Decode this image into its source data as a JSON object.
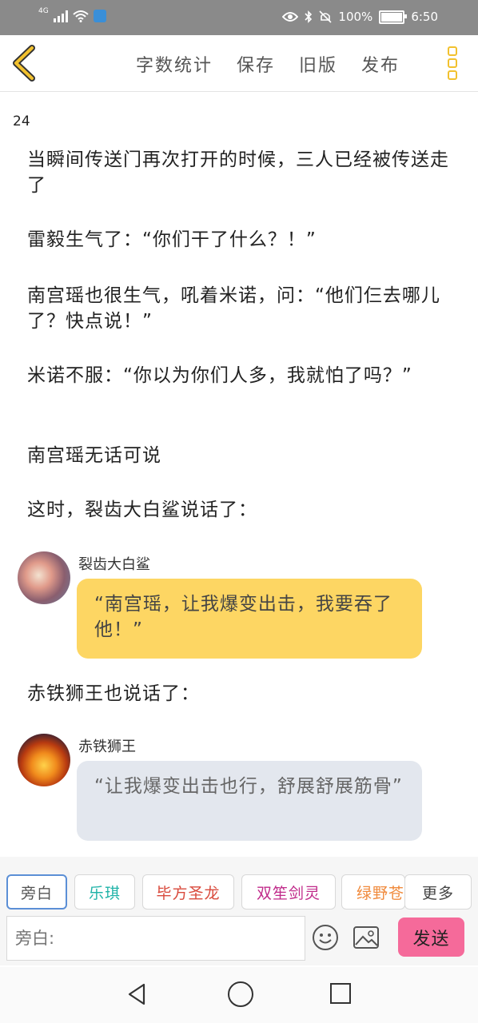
{
  "status_bar": {
    "network": "4G",
    "battery": "100%",
    "time": "6:50",
    "battery_level": 1.0
  },
  "toolbar": {
    "word_count": "字数统计",
    "save": "保存",
    "old_version": "旧版",
    "publish": "发布"
  },
  "chapter_number": "24",
  "paragraphs": [
    "当瞬间传送门再次打开的时候，三人已经被传送走了",
    "雷毅生气了：“你们干了什么？！”",
    "南宫瑶也很生气，吼着米诺，问：“他们仨去哪儿了？快点说！”",
    "米诺不服：“你以为你们人多，我就怕了吗？”",
    "南宫瑶无话可说",
    "这时，裂齿大白鲨说话了：",
    "赤铁狮王也说话了："
  ],
  "messages": [
    {
      "speaker": "裂齿大白鲨",
      "text": "“南宫瑶，让我爆变出击，我要吞了他！”"
    },
    {
      "speaker": "赤铁狮王",
      "text": "“让我爆变出击也行，舒展舒展筋骨”"
    }
  ],
  "characters": [
    "旁白",
    "乐琪",
    "毕方圣龙",
    "双笙剑灵",
    "绿野苍",
    "更多"
  ],
  "input": {
    "placeholder": "旁白:"
  },
  "send_label": "发送",
  "colors": {
    "accent_yellow": "#f2c12e",
    "bubble_yellow": "#fdd663",
    "bubble_gray": "#e3e7ee",
    "send_pink": "#f56a9a",
    "selected_border": "#5b8fd6"
  }
}
